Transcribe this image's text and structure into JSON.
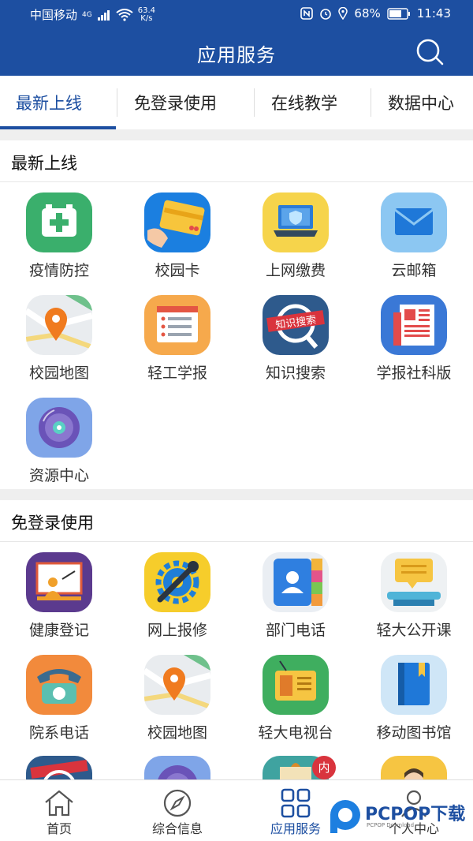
{
  "status_bar": {
    "carrier": "中国移动",
    "network": "4G",
    "speed_value": "63.4",
    "speed_unit": "K/s",
    "battery": "68%",
    "time": "11:43"
  },
  "header": {
    "title": "应用服务"
  },
  "tabs": [
    {
      "label": "最新上线",
      "active": true
    },
    {
      "label": "免登录使用",
      "active": false
    },
    {
      "label": "在线教学",
      "active": false
    },
    {
      "label": "数据中心",
      "active": false
    }
  ],
  "sections": [
    {
      "title": "最新上线",
      "apps": [
        {
          "label": "疫情防控",
          "icon": "medical-kit-icon"
        },
        {
          "label": "校园卡",
          "icon": "campus-card-icon"
        },
        {
          "label": "上网缴费",
          "icon": "laptop-shield-icon"
        },
        {
          "label": "云邮箱",
          "icon": "mail-envelope-icon"
        },
        {
          "label": "校园地图",
          "icon": "map-pin-icon"
        },
        {
          "label": "轻工学报",
          "icon": "journal-list-icon"
        },
        {
          "label": "知识搜索",
          "icon": "knowledge-search-icon"
        },
        {
          "label": "学报社科版",
          "icon": "newspaper-icon"
        },
        {
          "label": "资源中心",
          "icon": "disc-icon"
        }
      ]
    },
    {
      "title": "免登录使用",
      "apps": [
        {
          "label": "健康登记",
          "icon": "teacher-board-icon"
        },
        {
          "label": "网上报修",
          "icon": "repair-gear-wrench-icon"
        },
        {
          "label": "部门电话",
          "icon": "contacts-icon"
        },
        {
          "label": "轻大公开课",
          "icon": "open-course-icon"
        },
        {
          "label": "院系电话",
          "icon": "telephone-icon"
        },
        {
          "label": "校园地图",
          "icon": "map-pin-icon"
        },
        {
          "label": "轻大电视台",
          "icon": "radio-tv-icon"
        },
        {
          "label": "移动图书馆",
          "icon": "book-icon"
        }
      ],
      "partial_row_icons": [
        "knowledge-search-icon",
        "disc-icon",
        "library-building-icon",
        "person-icon"
      ],
      "badge": "内"
    }
  ],
  "bottom_nav": [
    {
      "label": "首页",
      "icon": "home-icon",
      "active": false
    },
    {
      "label": "综合信息",
      "icon": "compass-icon",
      "active": false
    },
    {
      "label": "应用服务",
      "icon": "grid-icon",
      "active": true
    },
    {
      "label": "个人中心",
      "icon": "person-icon",
      "active": false
    }
  ],
  "watermark": {
    "brand": "PCPOP下载",
    "sub": "PCPOP Download"
  },
  "colors": {
    "primary": "#1d4fa1",
    "background": "#ffffff",
    "divider": "#efefef"
  }
}
